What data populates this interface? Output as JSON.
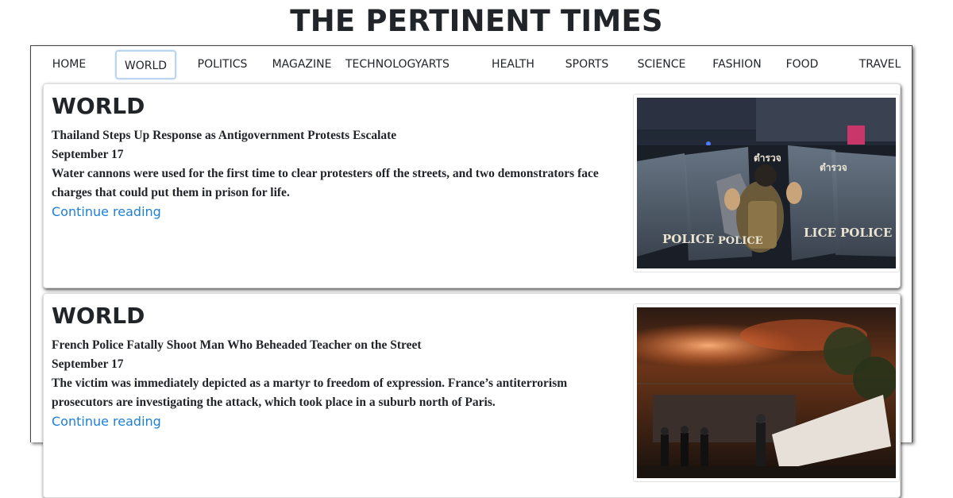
{
  "site": {
    "title": "THE PERTINENT TIMES"
  },
  "nav": {
    "items": [
      {
        "label": "HOME"
      },
      {
        "label": "WORLD"
      },
      {
        "label": "POLITICS"
      },
      {
        "label": "MAGAZINE"
      },
      {
        "label": "TECHNOLOGY"
      },
      {
        "label": "ARTS"
      },
      {
        "label": "HEALTH"
      },
      {
        "label": "SPORTS"
      },
      {
        "label": "SCIENCE"
      },
      {
        "label": "FASHION"
      },
      {
        "label": "FOOD"
      },
      {
        "label": "TRAVEL"
      }
    ],
    "active": "WORLD"
  },
  "articles": [
    {
      "section": "WORLD",
      "headline": "Thailand Steps Up Response as Antigovernment Protests Escalate",
      "date": "September 17",
      "summary": "Water cannons were used for the first time to clear protesters off the streets, and two demonstrators face charges that could put them in prison for life.",
      "link_text": "Continue reading",
      "image": {
        "shield_text": "POLICE",
        "shield_text_2": "POLICE",
        "shield_text_3": "LICE",
        "shield_text_4": "POLICE",
        "shield_text_5": "ตำรวจ",
        "shield_text_6": "ตำรวจ"
      }
    },
    {
      "section": "WORLD",
      "headline": "French Police Fatally Shoot Man Who Beheaded Teacher on the Street",
      "date": "September 17",
      "summary": "The victim was immediately depicted as a martyr to freedom of expression. France’s antiterrorism prosecutors are investigating the attack, which took place in a suburb north of Paris.",
      "link_text": "Continue reading"
    }
  ],
  "colors": {
    "link": "#1e7fd6",
    "active_border": "#b9d5f2"
  }
}
